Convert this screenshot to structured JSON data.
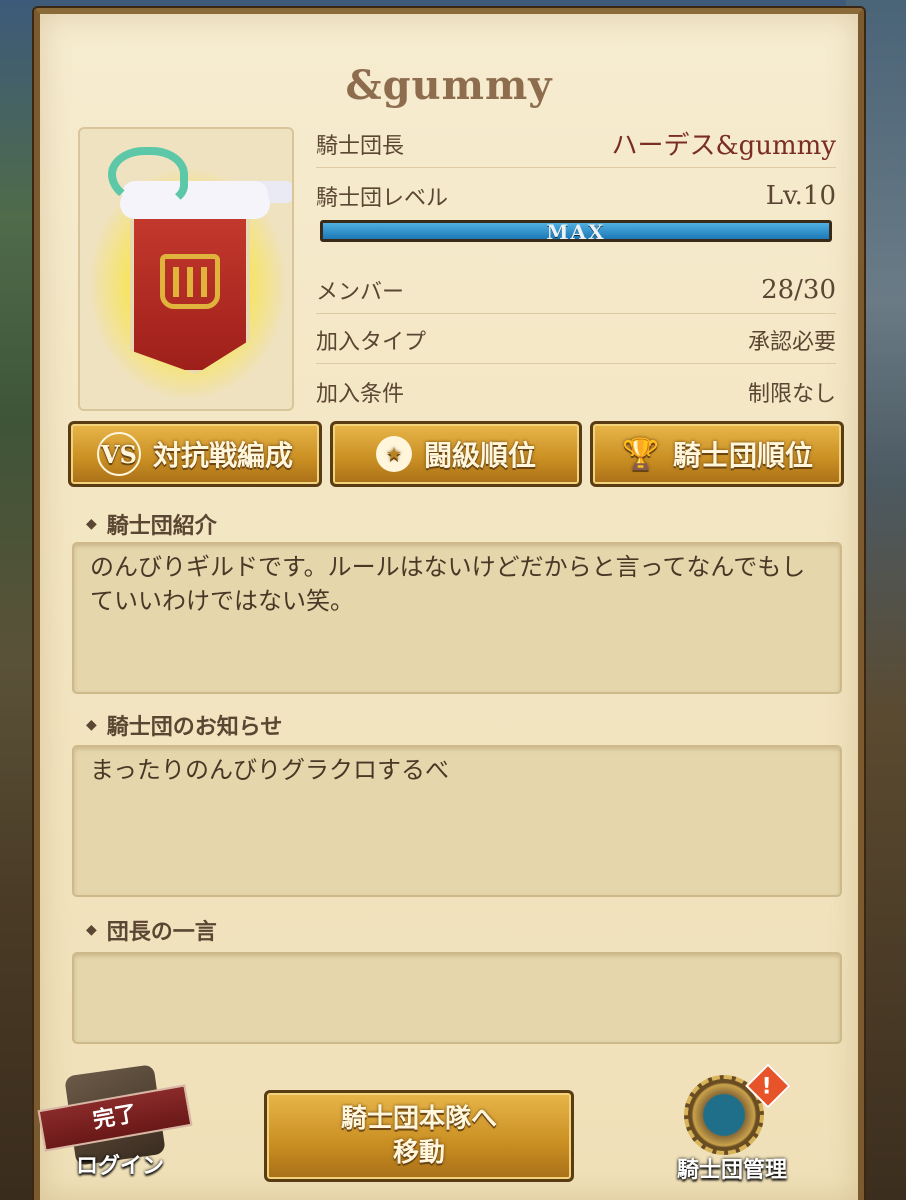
{
  "guild": {
    "name": "&gummy"
  },
  "info": {
    "leader_label": "騎士団長",
    "leader_value": "ハーデス&gummy",
    "level_label": "騎士団レベル",
    "level_value": "Lv.10",
    "level_progress": 1.0,
    "level_bar_text": "MAX",
    "members_label": "メンバー",
    "members_value": "28/30",
    "join_type_label": "加入タイプ",
    "join_type_value": "承認必要",
    "join_condition_label": "加入条件",
    "join_condition_value": "制限なし"
  },
  "buttons": {
    "battle_formation": "対抗戦編成",
    "rank_battle": "闘級順位",
    "guild_rank": "騎士団順位"
  },
  "sections": {
    "intro_title": "騎士団紹介",
    "intro_text": "のんびりギルドです。ルールはないけどだからと言ってなんでもしていいわけではない笑。",
    "notice_title": "騎士団のお知らせ",
    "notice_text": "まったりのんびりグラクロするべ",
    "leader_word_title": "団長の一言",
    "leader_word_text": ""
  },
  "bottom": {
    "login_stamp": "完了",
    "login_label": "ログイン",
    "move_line1": "騎士団本隊へ",
    "move_line2": "移動",
    "manage_label": "騎士団管理",
    "manage_alert": "!"
  },
  "colors": {
    "parchment": "#f3e6c3",
    "button_gold": "#c98e22",
    "leader_name": "#7a2d22",
    "level_bar": "#1d78b6"
  },
  "icons": {
    "vs": "vs-icon",
    "medal": "medal-icon",
    "trophy": "trophy-icon",
    "gear": "gear-icon",
    "alert": "alert-icon"
  }
}
